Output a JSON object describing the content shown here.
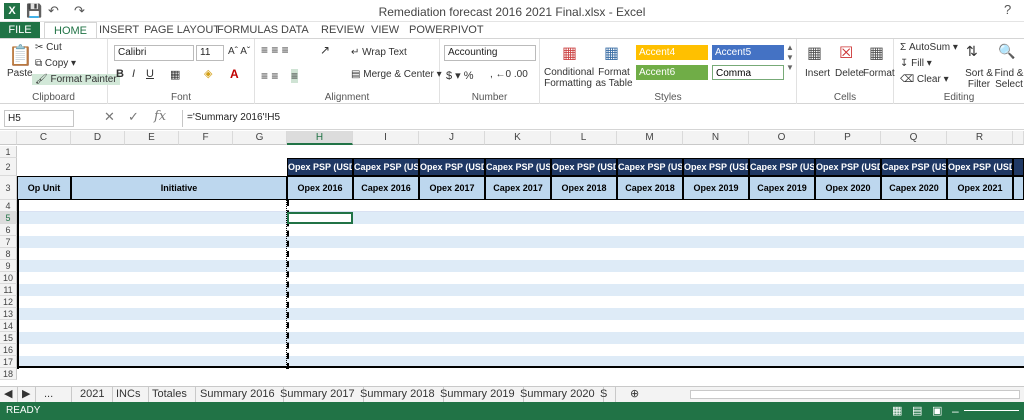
{
  "window": {
    "title": "Remediation forecast 2016 2021 Final.xlsx - Excel"
  },
  "ribbon_tabs": [
    "FILE",
    "HOME",
    "INSERT",
    "PAGE LAYOUT",
    "FORMULAS",
    "DATA",
    "REVIEW",
    "VIEW",
    "POWERPIVOT"
  ],
  "clipboard": {
    "paste": "Paste",
    "cut": "Cut",
    "copy": "Copy",
    "format_painter": "Format Painter",
    "label": "Clipboard"
  },
  "font": {
    "name": "Calibri",
    "size": "11",
    "label": "Font"
  },
  "alignment": {
    "wrap": "Wrap Text",
    "merge": "Merge & Center",
    "label": "Alignment"
  },
  "number": {
    "format": "Accounting",
    "label": "Number"
  },
  "styles": {
    "conditional": "Conditional Formatting",
    "format_table": "Format as Table",
    "accent4": "Accent4",
    "accent5": "Accent5",
    "accent6": "Accent6",
    "comma": "Comma",
    "label": "Styles"
  },
  "cells": {
    "insert": "Insert",
    "delete": "Delete",
    "format": "Format",
    "label": "Cells"
  },
  "editing": {
    "autosum": "AutoSum",
    "fill": "Fill",
    "clear": "Clear",
    "sort": "Sort & Filter",
    "find": "Find & Select",
    "label": "Editing"
  },
  "namebox": "H5",
  "formula": "='Summary 2016'!H5",
  "columns": [
    "C",
    "D",
    "E",
    "F",
    "G",
    "H",
    "I",
    "J",
    "K",
    "L",
    "M",
    "N",
    "O",
    "P",
    "Q",
    "R"
  ],
  "rows": [
    "1",
    "2",
    "3",
    "4",
    "5",
    "6",
    "7",
    "8",
    "9",
    "10",
    "11",
    "12",
    "13",
    "14",
    "15",
    "16",
    "17",
    "18"
  ],
  "table": {
    "group_header": "Opex PSP (USD)",
    "group_header_capex": "Capex PSP (USD)",
    "op_unit": "Op Unit",
    "initiative": "Initiative",
    "sub_headers": [
      "Opex 2016",
      "Capex 2016",
      "Opex 2017",
      "Capex 2017",
      "Opex 2018",
      "Capex 2018",
      "Opex 2019",
      "Capex 2019",
      "Opex 2020",
      "Capex 2020",
      "Opex 2021"
    ]
  },
  "sheet_tabs": [
    "2021",
    "INCs",
    "Totales",
    "Summary 2016",
    "Summary 2017",
    "Summary 2018",
    "Summary 2019",
    "Summary 2020",
    "S"
  ],
  "status": "READY"
}
